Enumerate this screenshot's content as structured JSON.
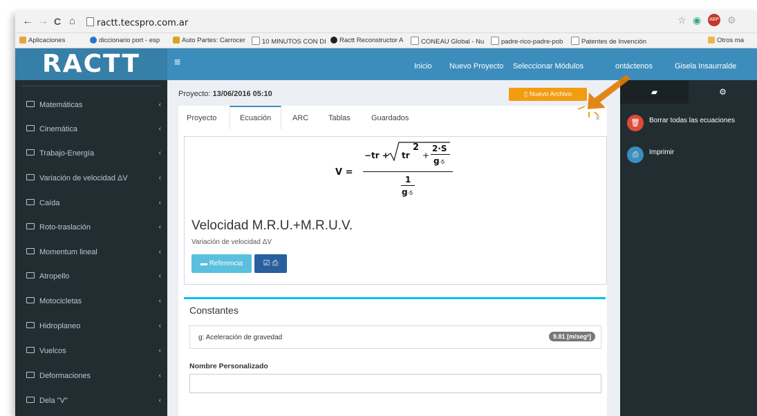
{
  "browser": {
    "nav": {
      "back": "←",
      "forward": "→",
      "reload": "C",
      "home": "⌂"
    },
    "url": "ractt.tecspro.com.ar",
    "bookmarks": [
      {
        "label": "Aplicaciones",
        "color": "#e8a33c"
      },
      {
        "label": "diccionario port - esp",
        "color": "#2a74c9"
      },
      {
        "label": "Auto Partes: Carrocer",
        "color": "#d9a31c"
      },
      {
        "label": "10 MINUTOS CON DI",
        "color": "#888888"
      },
      {
        "label": "Ractt Reconstructor A",
        "color": "#222222"
      },
      {
        "label": "CONEAU Global - Nu",
        "color": "#777777"
      },
      {
        "label": "padre-rico-padre-pob",
        "color": "#777777"
      },
      {
        "label": "Patentes de Invención",
        "color": "#777777"
      },
      {
        "label": "Otros ma",
        "color": "#e8b84a"
      }
    ]
  },
  "app": {
    "logo": "RACTT",
    "menu": [
      "Inicio",
      "Nuevo Proyecto",
      "Seleccionar Módulos",
      "ontáctenos",
      "Gisela Insaurralde"
    ],
    "sidebar": [
      "Matemáticas",
      "Cinemática",
      "Trabajo-Energía",
      "Variación de velocidad ΔV",
      "Caída",
      "Roto-traslación",
      "Momentum lineal",
      "Atropello",
      "Motocicletas",
      "Hidroplaneo",
      "Vuelcos",
      "Deformaciones",
      "Dela \"V\""
    ],
    "project": {
      "label": "Proyecto:",
      "value": "13/06/2016 05:10"
    },
    "new_file_button": "Nuevo Archivo",
    "tabs": [
      "Proyecto",
      "Ecuación",
      "ARC",
      "Tablas",
      "Guardados"
    ],
    "active_tab": "Ecuación",
    "close": "×",
    "formula": {
      "lhs": "V =",
      "neg_tr": "−tr +",
      "tr": "tr",
      "exp": "2",
      "plus": "+",
      "frac_num": "2·S",
      "frac_den_g": "g",
      "dot_delta": "·δ",
      "one": "1"
    },
    "equation_title": "Velocidad M.R.U.+M.R.U.V.",
    "equation_subtitle": "Variación de velocidad ΔV",
    "reference_button": "Referencia",
    "constants": {
      "title": "Constantes",
      "row_label": "g: Aceleración de gravedad",
      "row_value": "9.81  [m/seg²]"
    },
    "custom_name_label": "Nombre Personalizado",
    "right_panel": {
      "delete_all": "Borrar todas las ecuaciones",
      "print": "Imprimir"
    },
    "colors": {
      "accent": "#3c8dbc",
      "sidebar": "#222d32",
      "orange": "#f39c12",
      "danger": "#dd4b39"
    }
  }
}
